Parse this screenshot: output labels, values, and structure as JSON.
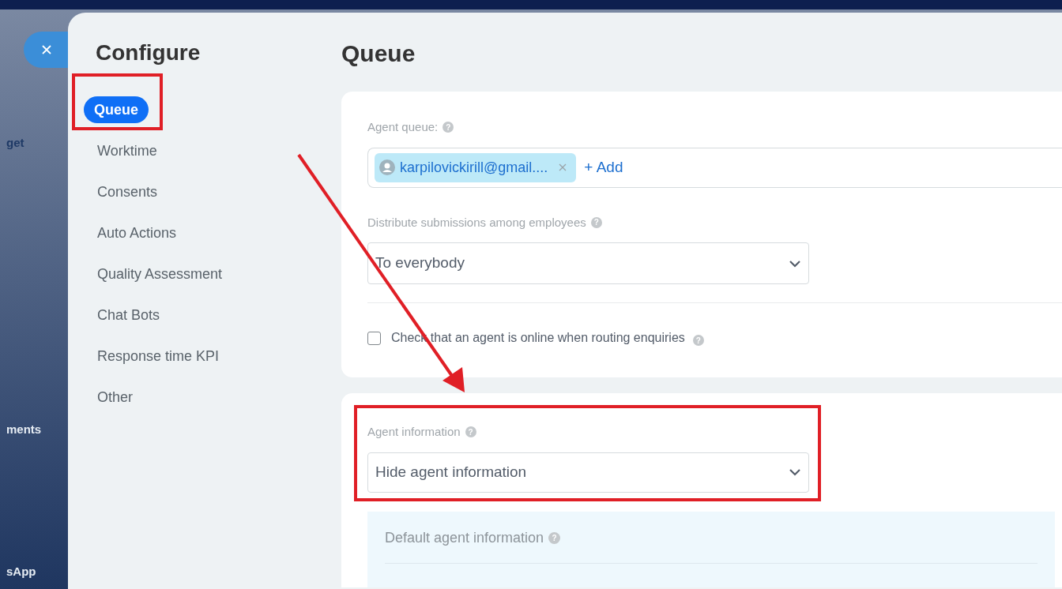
{
  "background_labels": [
    "get",
    "ments",
    "sApp"
  ],
  "sidebar": {
    "title": "Configure",
    "items": [
      {
        "label": "Queue",
        "selected": true
      },
      {
        "label": "Worktime",
        "selected": false
      },
      {
        "label": "Consents",
        "selected": false
      },
      {
        "label": "Auto Actions",
        "selected": false
      },
      {
        "label": "Quality Assessment",
        "selected": false
      },
      {
        "label": "Chat Bots",
        "selected": false
      },
      {
        "label": "Response time KPI",
        "selected": false
      },
      {
        "label": "Other",
        "selected": false
      }
    ]
  },
  "page_title": "Queue",
  "help_icons": [
    "?",
    "?",
    "?",
    "?",
    "?"
  ],
  "agent_queue": {
    "label": "Agent queue:",
    "tags": [
      {
        "text": "karpilovickirill@gmail...."
      }
    ],
    "add_link": "+ Add"
  },
  "distribute": {
    "label": "Distribute submissions among employees",
    "value": "To everybody"
  },
  "online_check": {
    "label": "Check that an agent is online when routing enquiries",
    "checked": false
  },
  "agent_information": {
    "label": "Agent information",
    "value": "Hide agent information"
  },
  "default_agent_information": {
    "label": "Default agent information"
  }
}
